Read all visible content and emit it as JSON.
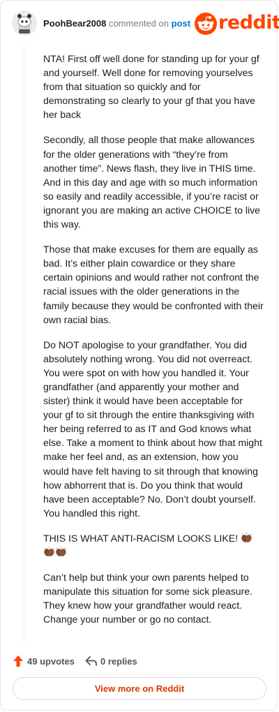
{
  "header": {
    "username": "PoohBear2008",
    "verb": "commented on",
    "post_link": "post",
    "logo_text": "reddit",
    "brand_color": "#ff4500"
  },
  "comment": {
    "paragraphs": [
      "NTA! First off well done for standing up for your gf and yourself. Well done for removing yourselves from that situation so quickly and for demonstrating so clearly to your gf that you have her back",
      "Secondly, all those people that make allowances for the older generations with “they’re from another time”. News flash, they live in THIS time. And in this day and age with so much information so easily and readily accessible, if you’re racist or ignorant you are making an active CHOICE to live this way.",
      "Those that make excuses for them are equally as bad. It’s either plain cowardice or they share certain opinions and would rather not confront the racial issues with the older generations in the family because they would be confronted with their own racial bias.",
      "Do NOT apologise to your grandfather. You did absolutely nothing wrong. You did not overreact. You were spot on with how you handled it. Your grandfather (and apparently your mother and sister) think it would have been acceptable for your gf to sit through the entire thanksgiving with her being referred to as IT and God knows what else. Take a moment to think about how that might make her feel and, as an extension, how you would have felt having to sit through that knowing how abhorrent that is. Do you think that would have been acceptable? No. Don’t doubt yourself. You handled this right.",
      "THIS IS WHAT ANTI-RACISM LOOKS LIKE!",
      "Can’t help but think your own parents helped to manipulate this situation for some sick pleasure. They knew how your grandfather would react. Change your number or go no contact."
    ],
    "emoji": [
      "clapping-hands",
      "clapping-hands",
      "clapping-hands"
    ]
  },
  "actions": {
    "upvotes": "49 upvotes",
    "replies": "0 replies",
    "upvote_color": "#ff4500"
  },
  "footer": {
    "view_more": "View more on Reddit"
  }
}
